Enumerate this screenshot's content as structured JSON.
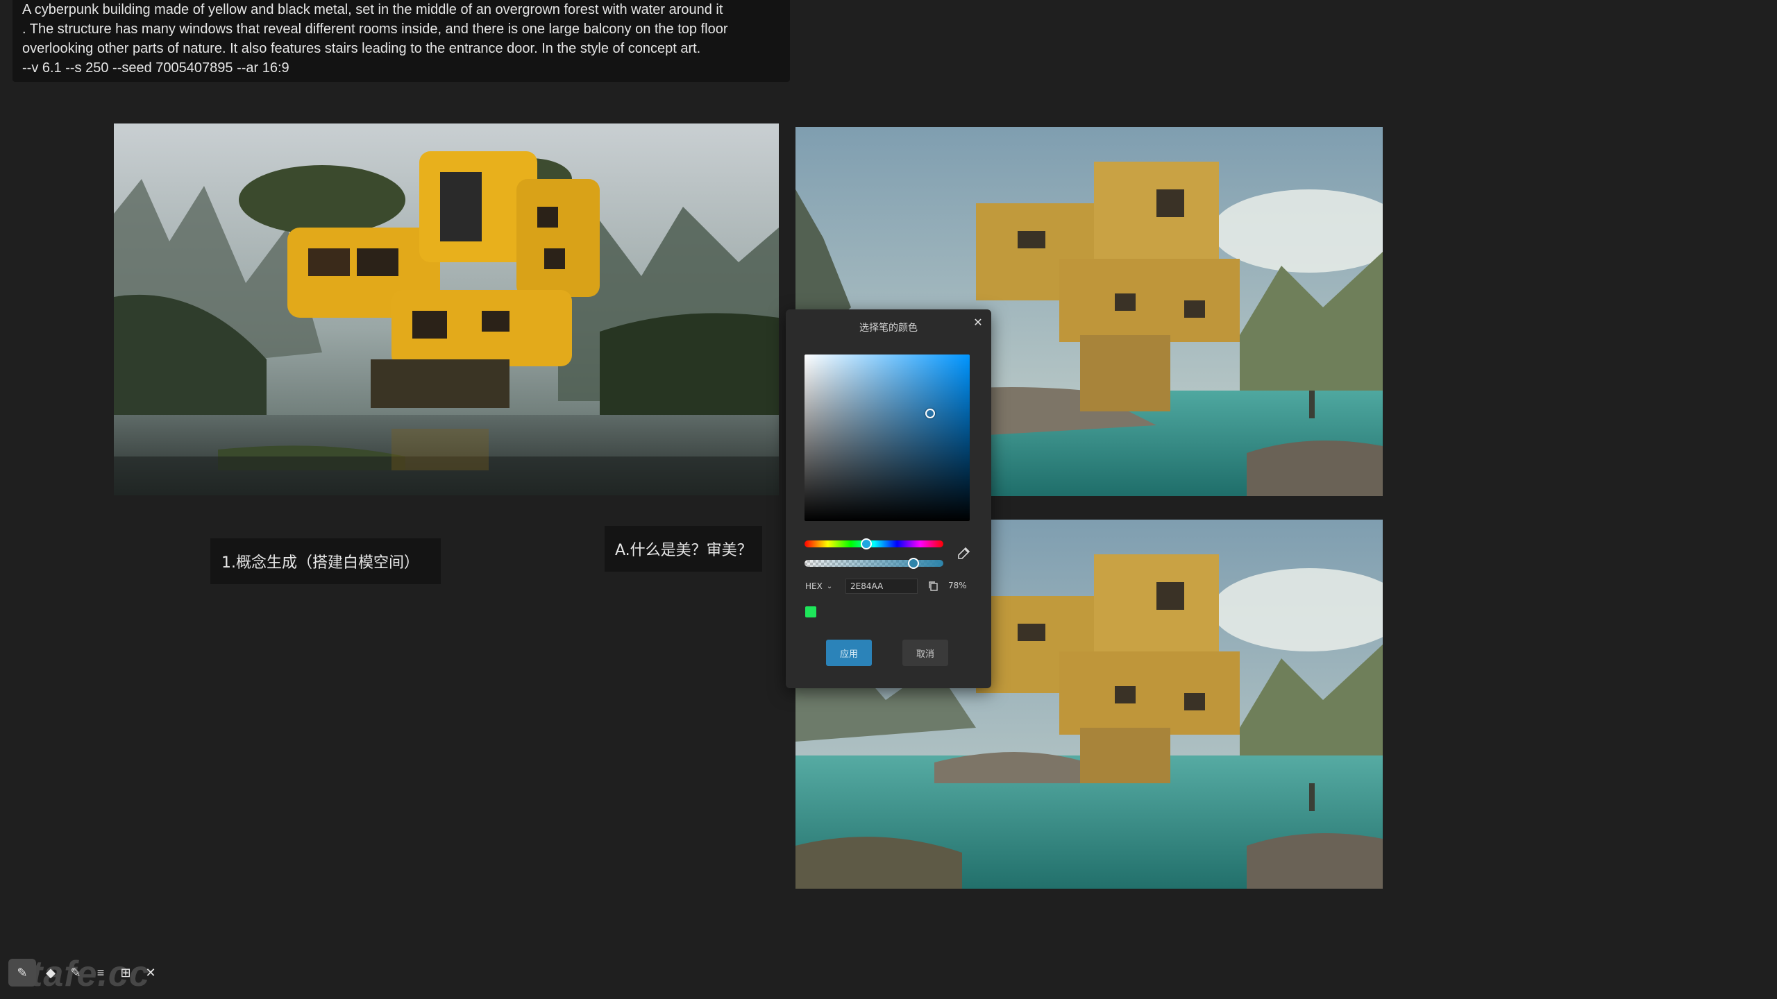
{
  "prompt": {
    "lines": [
      "A cyberpunk building made of yellow and black metal, set in the middle of an overgrown forest with water around it",
      ". The structure has many windows that reveal different rooms inside, and there is one large balcony on the top floor",
      " overlooking other parts of nature. It also features stairs leading to the entrance door. In the style of concept art.",
      "--v 6.1  --s 250 --seed 7005407895 --ar 16:9"
    ]
  },
  "labels": {
    "concept": "1.概念生成（搭建白模空间）",
    "aesthetics": "A.什么是美？审美？"
  },
  "color_picker": {
    "title": "选择笔的颜色",
    "format": "HEX",
    "hex_value": "2E84AA",
    "alpha": "78%",
    "apply_label": "应用",
    "cancel_label": "取消",
    "swatch_color": "#1ee65a",
    "current_color": "#2e84aa",
    "alpha_fraction": 0.78
  },
  "watermark": "tafe.cc",
  "toolbar": {
    "tools": [
      "pen-icon",
      "eraser-icon",
      "highlighter-icon",
      "menu-icon",
      "grid-icon",
      "close-icon"
    ]
  },
  "images": [
    {
      "name": "yellow-cyberpunk-house-forest"
    },
    {
      "name": "yellow-block-house-lake-top"
    },
    {
      "name": "yellow-block-house-lake-bottom"
    }
  ]
}
